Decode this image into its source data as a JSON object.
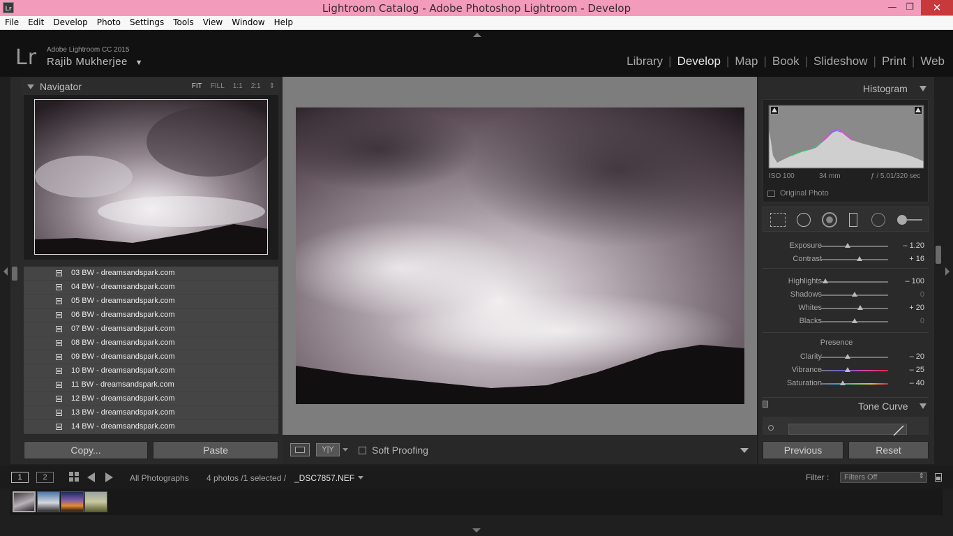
{
  "window": {
    "title": "Lightroom Catalog - Adobe Photoshop Lightroom - Develop",
    "app_icon_text": "Lr",
    "minimize": "—",
    "maximize": "❐",
    "close": "✕"
  },
  "menu": [
    "File",
    "Edit",
    "Develop",
    "Photo",
    "Settings",
    "Tools",
    "View",
    "Window",
    "Help"
  ],
  "identity": {
    "logo": "Lr",
    "product": "Adobe Lightroom CC 2015",
    "user": "Rajib Mukherjee",
    "modules": [
      "Library",
      "Develop",
      "Map",
      "Book",
      "Slideshow",
      "Print",
      "Web"
    ],
    "active_module": "Develop"
  },
  "navigator": {
    "title": "Navigator",
    "zoom": [
      "FIT",
      "FILL",
      "1:1",
      "2:1"
    ],
    "zoom_active": "FIT"
  },
  "files": [
    "03 BW - dreamsandspark.com",
    "04 BW - dreamsandspark.com",
    "05 BW - dreamsandspark.com",
    "06 BW - dreamsandspark.com",
    "07 BW - dreamsandspark.com",
    "08 BW - dreamsandspark.com",
    "09 BW - dreamsandspark.com",
    "10 BW - dreamsandspark.com",
    "11 BW - dreamsandspark.com",
    "12 BW - dreamsandspark.com",
    "13 BW - dreamsandspark.com",
    "14 BW - dreamsandspark.com"
  ],
  "left_buttons": {
    "copy": "Copy...",
    "paste": "Paste"
  },
  "toolbar": {
    "yy": "Y|Y",
    "soft_proofing": "Soft Proofing"
  },
  "histogram": {
    "title": "Histogram",
    "iso": "ISO 100",
    "focal": "34 mm",
    "aperture": "ƒ / 5.0",
    "shutter": "1/320 sec",
    "original_photo": "Original Photo"
  },
  "basic": {
    "tone": [
      {
        "label": "Exposure",
        "value": "– 1.20",
        "pos": 0.4
      },
      {
        "label": "Contrast",
        "value": "+ 16",
        "pos": 0.58
      }
    ],
    "tone2": [
      {
        "label": "Highlights",
        "value": "– 100",
        "pos": 0.0
      },
      {
        "label": "Shadows",
        "value": "0",
        "pos": 0.5
      },
      {
        "label": "Whites",
        "value": "+ 20",
        "pos": 0.6
      },
      {
        "label": "Blacks",
        "value": "0",
        "pos": 0.5
      }
    ],
    "presence_title": "Presence",
    "presence": [
      {
        "label": "Clarity",
        "value": "– 20",
        "pos": 0.4
      },
      {
        "label": "Vibrance",
        "value": "– 25",
        "pos": 0.38
      },
      {
        "label": "Saturation",
        "value": "– 40",
        "pos": 0.3
      }
    ]
  },
  "tone_curve": {
    "title": "Tone Curve"
  },
  "right_buttons": {
    "previous": "Previous",
    "reset": "Reset"
  },
  "status": {
    "view1": "1",
    "view2": "2",
    "source": "All Photographs",
    "count": "4 photos /1 selected /",
    "filename": "_DSC7857.NEF",
    "filter_label": "Filter :",
    "filter_value": "Filters Off"
  }
}
